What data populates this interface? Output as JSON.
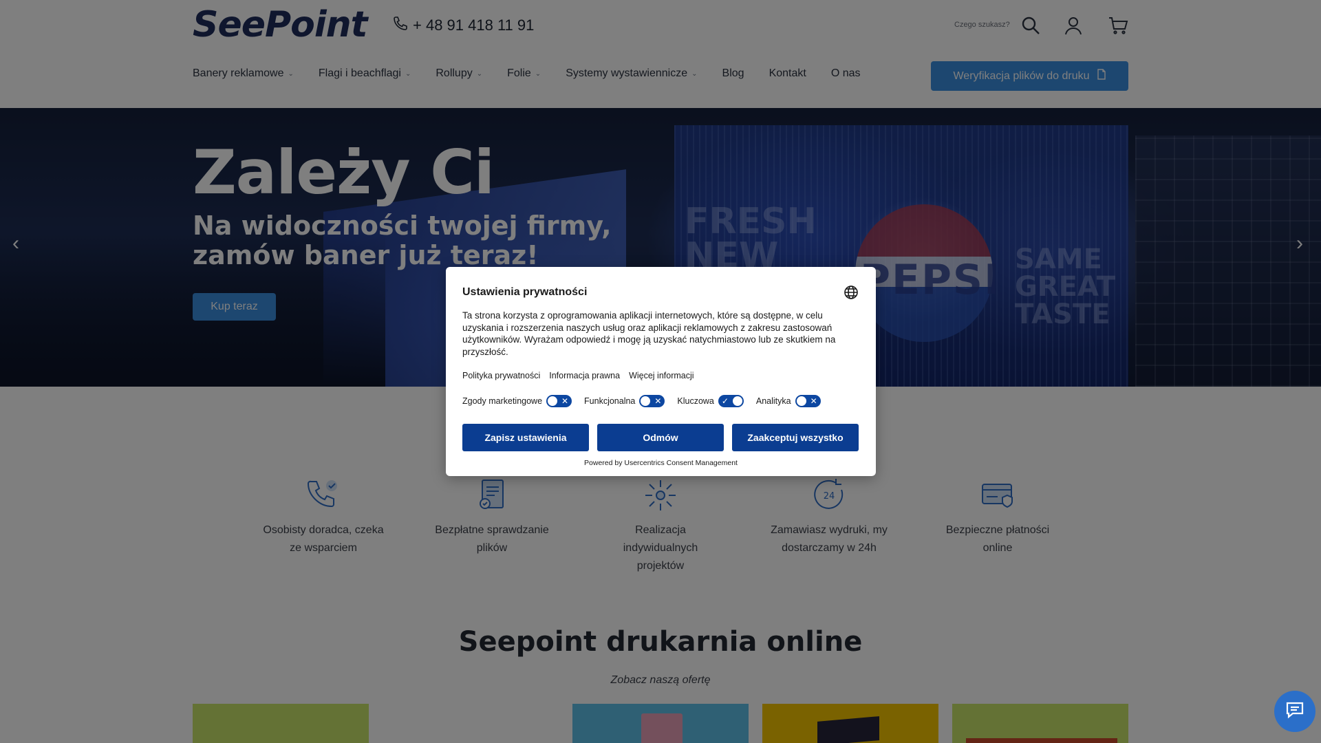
{
  "header": {
    "logo": "SeePoint",
    "phone": "+ 48 91 418 11 91",
    "search_label": "Czego szukasz?",
    "nav": [
      {
        "label": "Banery reklamowe",
        "has_dropdown": true
      },
      {
        "label": "Flagi i beachflagi",
        "has_dropdown": true
      },
      {
        "label": "Rollupy",
        "has_dropdown": true
      },
      {
        "label": "Folie",
        "has_dropdown": true
      },
      {
        "label": "Systemy wystawiennicze",
        "has_dropdown": true
      },
      {
        "label": "Blog",
        "has_dropdown": false
      },
      {
        "label": "Kontakt",
        "has_dropdown": false
      },
      {
        "label": "O nas",
        "has_dropdown": false
      }
    ],
    "verify_button": "Weryfikacja plików do druku"
  },
  "hero": {
    "title": "Zależy Ci",
    "subtitle": "Na widoczności twojej firmy, zamów baner już teraz!",
    "button": "Kup teraz",
    "ad_fresh": "FRESH NEW LOOK",
    "ad_pepsi": "PEPSI",
    "ad_same": "SAME GREAT TASTE"
  },
  "features": [
    {
      "icon": "phone-check-icon",
      "text": "Osobisty doradca, czeka ze wsparciem"
    },
    {
      "icon": "document-check-icon",
      "text": "Bezpłatne sprawdzanie plików"
    },
    {
      "icon": "custom-project-icon",
      "text": "Realizacja indywidualnych projektów"
    },
    {
      "icon": "clock-24-icon",
      "text": "Zamawiasz wydruki, my dostarczamy w 24h"
    },
    {
      "icon": "card-secure-icon",
      "text": "Bezpieczne płatności online"
    }
  ],
  "section": {
    "title": "Seepoint drukarnia online",
    "subtitle": "Zobacz naszą ofertę"
  },
  "consent": {
    "title": "Ustawienia prywatności",
    "body": "Ta strona korzysta z oprogramowania aplikacji internetowych, które są dostępne, w celu uzyskania i rozszerzenia naszych usług oraz aplikacji reklamowych z zakresu zastosowań użytkowników. Wyrażam odpowiedź i mogę ją uzyskać natychmiastowo lub ze skutkiem na przyszłość.",
    "links": [
      "Polityka prywatności",
      "Informacja prawna",
      "Więcej informacji"
    ],
    "toggles": [
      {
        "label": "Zgody marketingowe",
        "on": false
      },
      {
        "label": "Funkcjonalna",
        "on": false
      },
      {
        "label": "Kluczowa",
        "on": true
      },
      {
        "label": "Analityka",
        "on": false
      }
    ],
    "buttons": {
      "save": "Zapisz ustawienia",
      "deny": "Odmów",
      "accept_all": "Zaakceptuj wszystko"
    },
    "powered_by": "Powered by Usercentrics Consent Management"
  },
  "colors": {
    "accent": "#3b8fe0",
    "consent_button": "#0b3d91",
    "logo": "#1f2d5c"
  }
}
